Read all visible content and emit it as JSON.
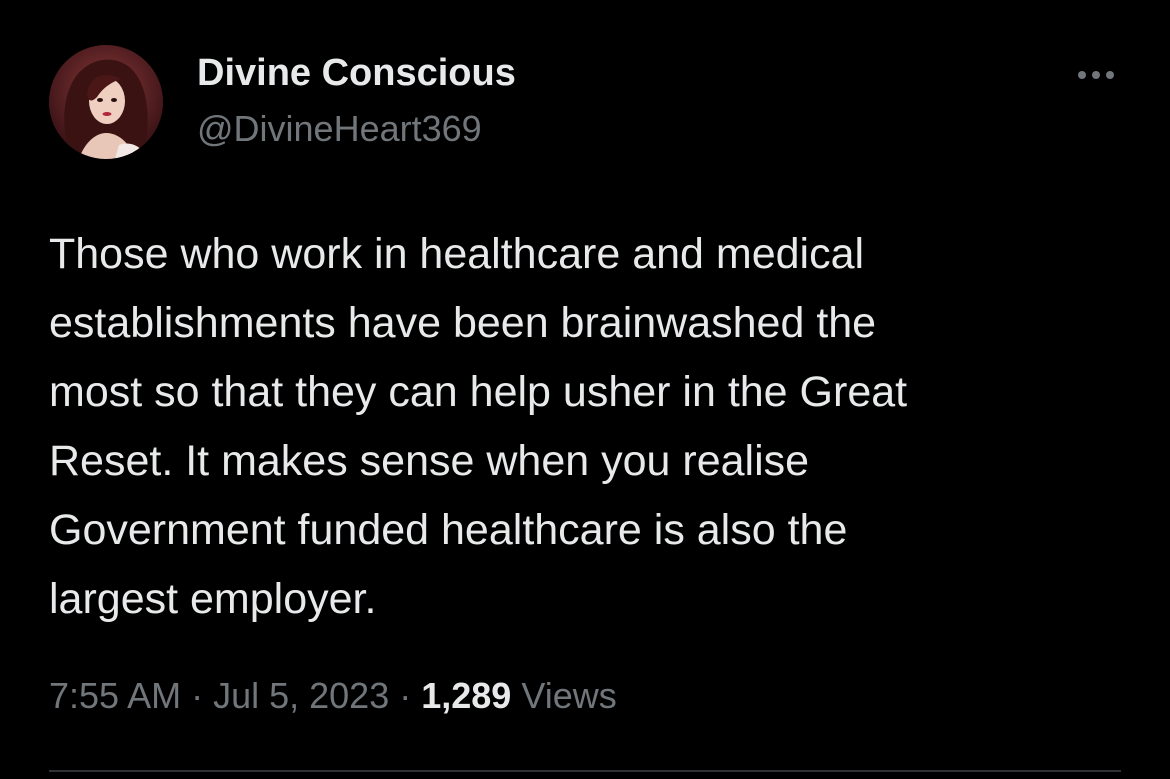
{
  "author": {
    "display_name": "Divine Conscious",
    "handle": "@DivineHeart369",
    "avatar_icon": "profile-avatar"
  },
  "more_icon": "more-options-icon",
  "tweet": {
    "lines": [
      "Those who work in healthcare and medical",
      "establishments have been brainwashed the",
      "most so that they can help usher in the Great",
      "Reset. It makes sense when you realise",
      "Government funded healthcare is also the",
      "largest employer."
    ]
  },
  "meta": {
    "time": "7:55 AM",
    "separator": "·",
    "date": "Jul 5, 2023",
    "views_count": "1,289",
    "views_label": "Views"
  },
  "colors": {
    "background": "#000000",
    "primary_text": "#e7e9ea",
    "secondary_text": "#71767b",
    "divider": "#2f3336"
  }
}
